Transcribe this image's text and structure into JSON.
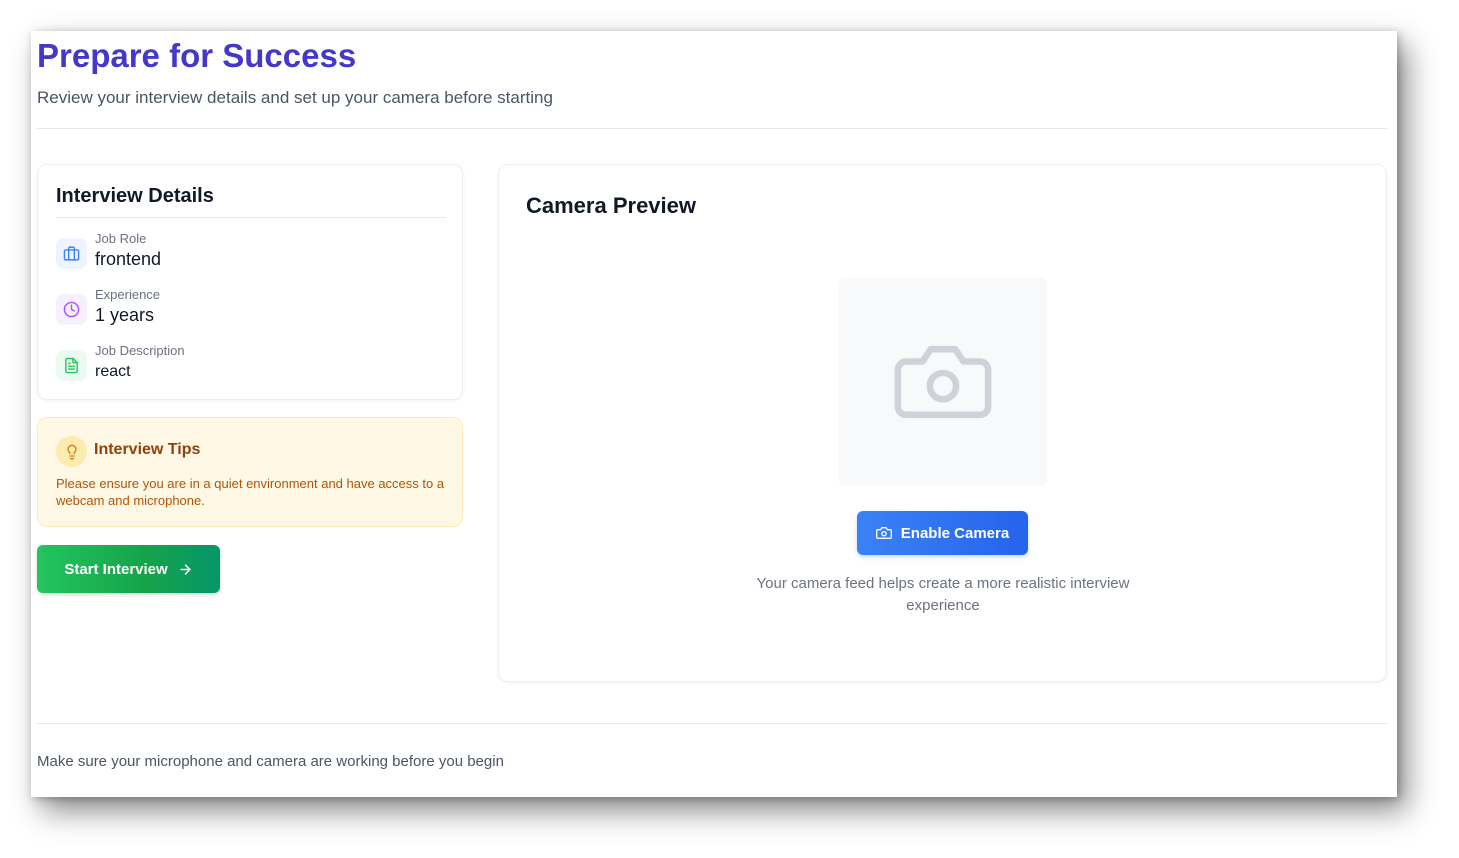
{
  "header": {
    "title": "Prepare for Success",
    "subtitle": "Review your interview details and set up your camera before starting"
  },
  "details": {
    "title": "Interview Details",
    "items": [
      {
        "label": "Job Role",
        "value": "frontend",
        "icon": "briefcase-icon",
        "color": "#3b82f6",
        "bg": "#eef4ff"
      },
      {
        "label": "Experience",
        "value": "1 years",
        "icon": "clock-icon",
        "color": "#a855f7",
        "bg": "#f6effe"
      },
      {
        "label": "Job Description",
        "value": "react",
        "icon": "document-icon",
        "color": "#22c55e",
        "bg": "#ecfbf1"
      }
    ]
  },
  "tips": {
    "title": "Interview Tips",
    "text": "Please ensure you are in a quiet environment and have access to a webcam and microphone.",
    "icon": "lightbulb-icon"
  },
  "actions": {
    "start_label": "Start Interview",
    "start_icon": "arrow-right-icon"
  },
  "camera": {
    "title": "Camera Preview",
    "placeholder_icon": "camera-icon",
    "enable_label": "Enable Camera",
    "note": "Your camera feed helps create a more realistic interview experience"
  },
  "footer": {
    "note": "Make sure your microphone and camera are working before you begin"
  },
  "colors": {
    "accent": "#4338ca",
    "primary_button": "#3b82f6",
    "success_button": "#16a34a",
    "tips_bg": "#fef8e4",
    "tips_text": "#b45309"
  }
}
